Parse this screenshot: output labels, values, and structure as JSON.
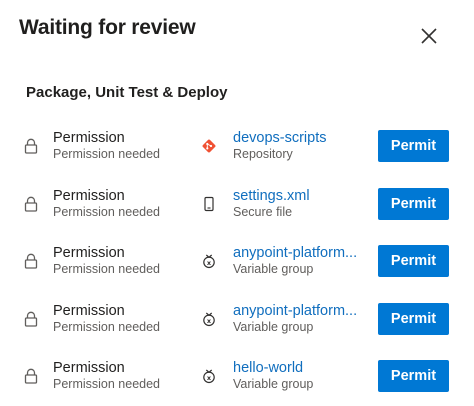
{
  "dialog": {
    "title": "Waiting for review",
    "close_icon": "close-icon"
  },
  "stage": {
    "title": "Package, Unit Test & Deploy"
  },
  "rows": [
    {
      "permission": "Permission",
      "status": "Permission needed",
      "resource_name": "devops-scripts",
      "resource_type": "Repository",
      "resource_icon": "git-repo-icon",
      "button": "Permit"
    },
    {
      "permission": "Permission",
      "status": "Permission needed",
      "resource_name": "settings.xml",
      "resource_type": "Secure file",
      "resource_icon": "secure-file-icon",
      "button": "Permit"
    },
    {
      "permission": "Permission",
      "status": "Permission needed",
      "resource_name": "anypoint-platform...",
      "resource_type": "Variable group",
      "resource_icon": "variable-group-icon",
      "button": "Permit"
    },
    {
      "permission": "Permission",
      "status": "Permission needed",
      "resource_name": "anypoint-platform...",
      "resource_type": "Variable group",
      "resource_icon": "variable-group-icon",
      "button": "Permit"
    },
    {
      "permission": "Permission",
      "status": "Permission needed",
      "resource_name": "hello-world",
      "resource_type": "Variable group",
      "resource_icon": "variable-group-icon",
      "button": "Permit"
    }
  ],
  "colors": {
    "accent": "#0078d4",
    "link": "#106ebe",
    "git": "#f05133",
    "text": "#201f1e",
    "muted": "#605e5c"
  }
}
